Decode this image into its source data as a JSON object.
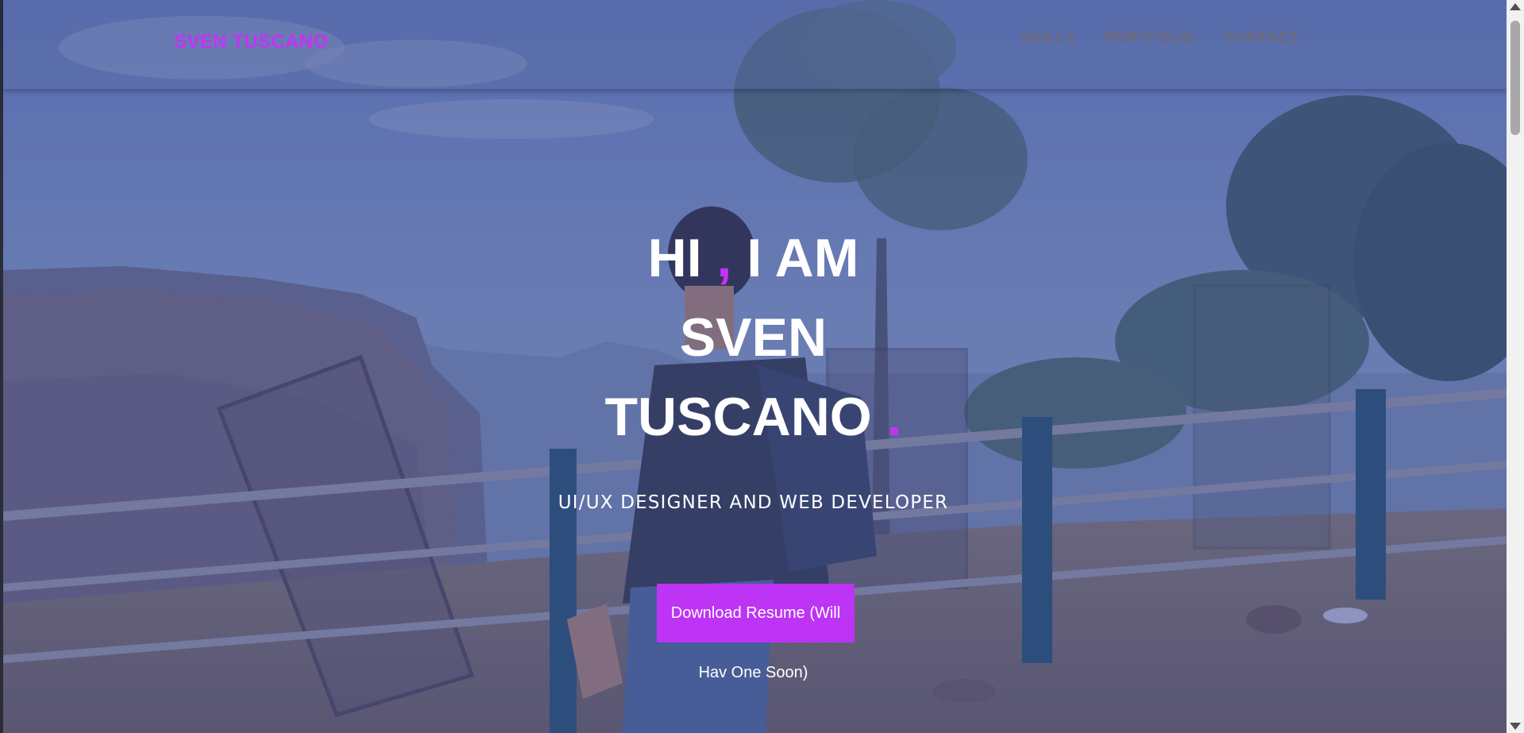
{
  "navbar": {
    "brand": "SVEN TUSCANO",
    "links": [
      "SKILLS",
      "PORTFOLIO",
      "CONTACT"
    ]
  },
  "hero": {
    "line1_a": "HI ",
    "line1_accent": ",",
    "line1_b": " I AM",
    "line2": "SVEN",
    "line3": "TUSCANO ",
    "line3_accent": ".",
    "subtitle": "UI/UX DESIGNER AND WEB DEVELOPER",
    "button_label": "Download Resume (Will",
    "button_tail": "Hav One Soon)"
  },
  "colors": {
    "accent": "#c333f5",
    "button": "#bd34f5",
    "overlay": "#3e4c96",
    "nav_link": "#6e6a78"
  },
  "icons": {
    "scroll_up": "triangle-up",
    "scroll_down": "triangle-down"
  }
}
